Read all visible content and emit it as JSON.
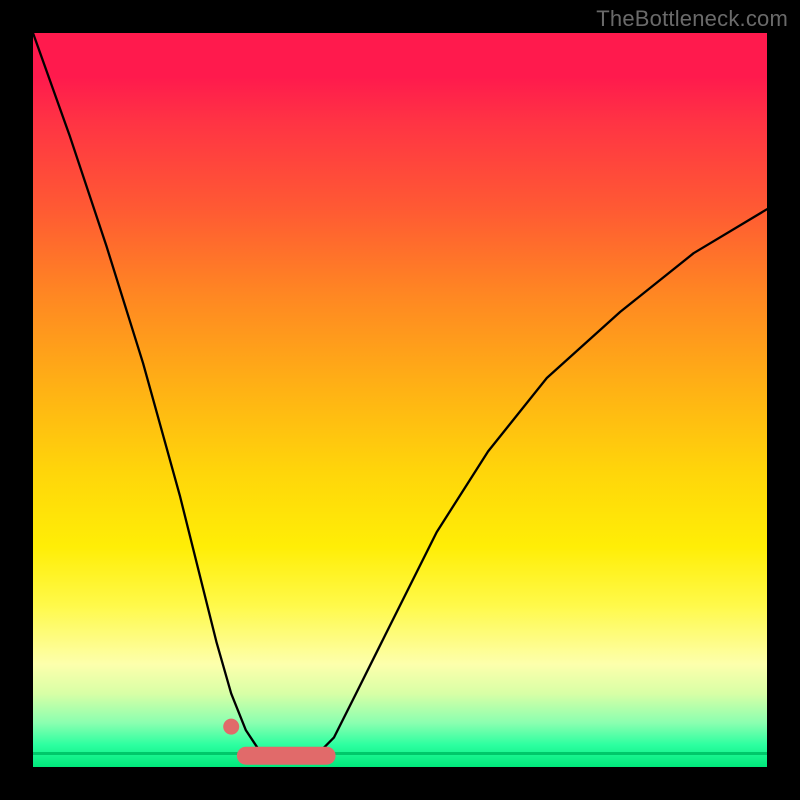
{
  "watermark": "TheBottleneck.com",
  "chart_data": {
    "type": "line",
    "title": "",
    "xlabel": "",
    "ylabel": "",
    "xlim": [
      0,
      1
    ],
    "ylim": [
      0,
      1
    ],
    "curve": {
      "x": [
        0.0,
        0.05,
        0.1,
        0.15,
        0.2,
        0.25,
        0.27,
        0.29,
        0.31,
        0.33,
        0.35,
        0.37,
        0.39,
        0.41,
        0.44,
        0.48,
        0.55,
        0.62,
        0.7,
        0.8,
        0.9,
        1.0
      ],
      "y": [
        1.0,
        0.86,
        0.71,
        0.55,
        0.37,
        0.17,
        0.1,
        0.05,
        0.02,
        0.01,
        0.01,
        0.01,
        0.02,
        0.04,
        0.1,
        0.18,
        0.32,
        0.43,
        0.53,
        0.62,
        0.7,
        0.76
      ]
    },
    "minimum_highlight": {
      "x_range": [
        0.29,
        0.4
      ],
      "y": 0.01,
      "isolated_point_x": 0.27
    },
    "background_gradient": {
      "top_color": "#ff1a4d",
      "bottom_color": "#00e87b"
    }
  }
}
